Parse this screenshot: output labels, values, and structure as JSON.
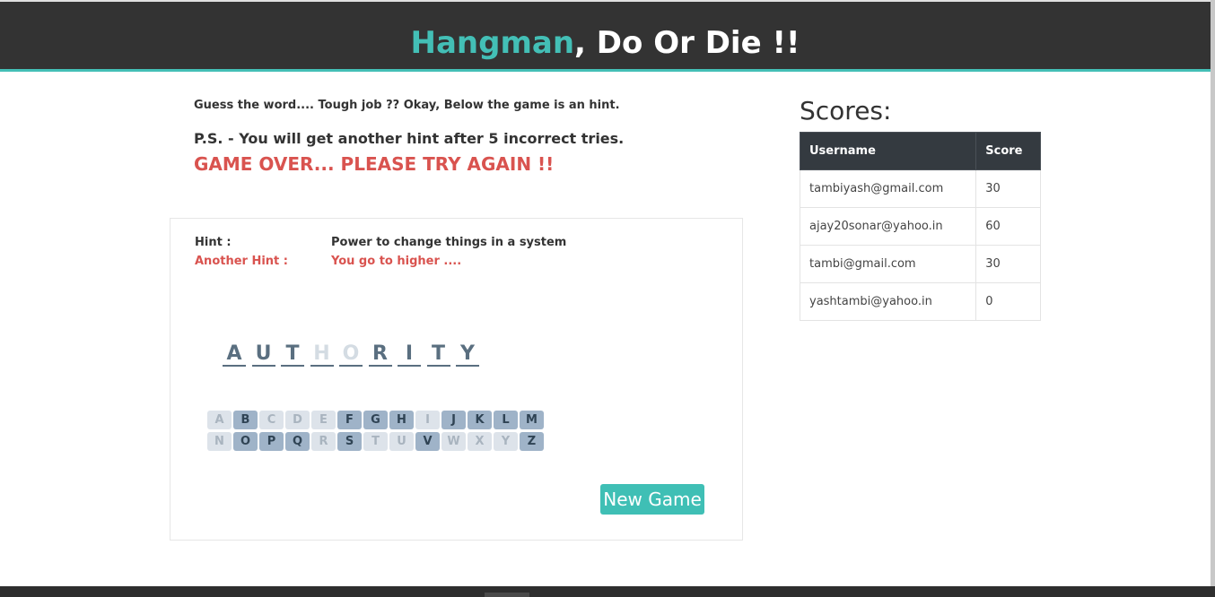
{
  "header": {
    "title_accent": "Hangman",
    "title_rest": ", Do Or Die !!",
    "accent_color": "#43bfb6"
  },
  "intro": {
    "line1": "Guess the word.... Tough job ?? Okay, Below the game is an hint.",
    "line2": "P.S. - You will get another hint after 5 incorrect tries.",
    "status": "GAME OVER... PLEASE TRY AGAIN !!"
  },
  "hints": {
    "hint_label": "Hint :",
    "hint_value": "Power to change things in a system",
    "another_label": "Another Hint :",
    "another_value": "You go to higher ...."
  },
  "word": {
    "letters": [
      "A",
      "U",
      "T",
      "H",
      "O",
      "R",
      "I",
      "T",
      "Y"
    ]
  },
  "keyboard": {
    "row1": [
      "A",
      "B",
      "C",
      "D",
      "E",
      "F",
      "G",
      "H",
      "I",
      "J",
      "K",
      "L",
      "M"
    ],
    "row2": [
      "N",
      "O",
      "P",
      "Q",
      "R",
      "S",
      "T",
      "U",
      "V",
      "W",
      "X",
      "Y",
      "Z"
    ]
  },
  "new_game_label": "New Game",
  "scores": {
    "title": "Scores:",
    "headers": [
      "Username",
      "Score"
    ],
    "rows": [
      [
        "tambiyash@gmail.com",
        "30"
      ],
      [
        "ajay20sonar@yahoo.in",
        "60"
      ],
      [
        "tambi@gmail.com",
        "30"
      ],
      [
        "yashtambi@yahoo.in",
        "0"
      ]
    ]
  },
  "colors": {
    "error": "#d9534f",
    "button": "#3fbfb5",
    "key_available": "#9fb3c8",
    "key_used": "#dde3ea"
  }
}
